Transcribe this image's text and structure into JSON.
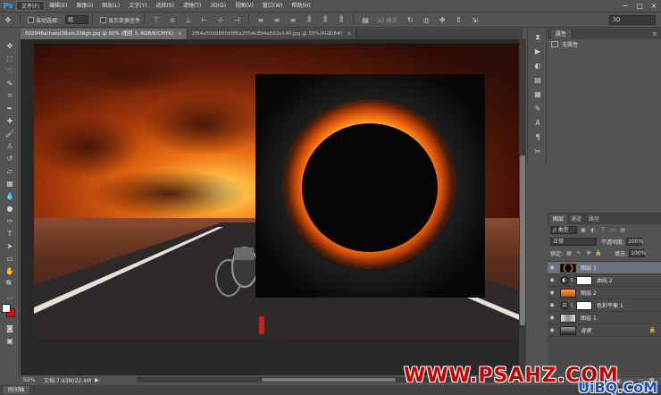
{
  "app": {
    "logo": "Ps"
  },
  "menu": [
    "文件(F)",
    "编辑(E)",
    "图像(I)",
    "图层(L)",
    "文字(Y)",
    "选择(S)",
    "滤镜(T)",
    "3D(D)",
    "视图(V)",
    "窗口(W)",
    "帮助(H)"
  ],
  "window_controls": {
    "minimize": "−",
    "maximize": "□",
    "close": "×"
  },
  "options": {
    "auto_select_label": "自动选择：",
    "auto_select_value": "组",
    "show_transform_label": "显示变换控件",
    "mode_3d_label": "3D 模式：",
    "workspace_value": "3D"
  },
  "tabs": [
    {
      "label": "002948athabd38sdc238gh.jpg @ 50% (图层 3, RGB/8/CMYK)",
      "close": "×"
    },
    {
      "label": "2f64a50b9860d8f6e2554c894e502e140.jpg @ 50%(RGB/8#)",
      "close": "×"
    }
  ],
  "status": {
    "zoom": "50%",
    "doc_info": "文档:7.93M/22.4M",
    "arrow": "▶"
  },
  "timeline_label": "时间轴",
  "properties": {
    "tab": "属性",
    "menu": "≡",
    "no_properties": "无属性"
  },
  "layers": {
    "tabs": [
      "图层",
      "通道",
      "路径"
    ],
    "filter_kind": "ρ 类型",
    "blend_mode": "正常",
    "opacity_label": "不透明度:",
    "opacity_value": "100%",
    "lock_label": "锁定:",
    "fill_label": "填充:",
    "fill_value": "100%",
    "items": [
      {
        "name": "图层 3",
        "selected": true
      },
      {
        "name": "曲线 2",
        "selected": false
      },
      {
        "name": "图层 2",
        "selected": false
      },
      {
        "name": "色彩平衡 1",
        "selected": false
      },
      {
        "name": "图层 1",
        "selected": false
      },
      {
        "name": "背景",
        "selected": false
      }
    ]
  },
  "watermark": {
    "main": "WWW.PSAHZ.COM",
    "sub": "UiBQ.CoM"
  },
  "colors": {
    "foreground": "#ffffff",
    "background": "#ff0000",
    "selected_layer": "#6a7280",
    "ui_gray": "#535353"
  }
}
